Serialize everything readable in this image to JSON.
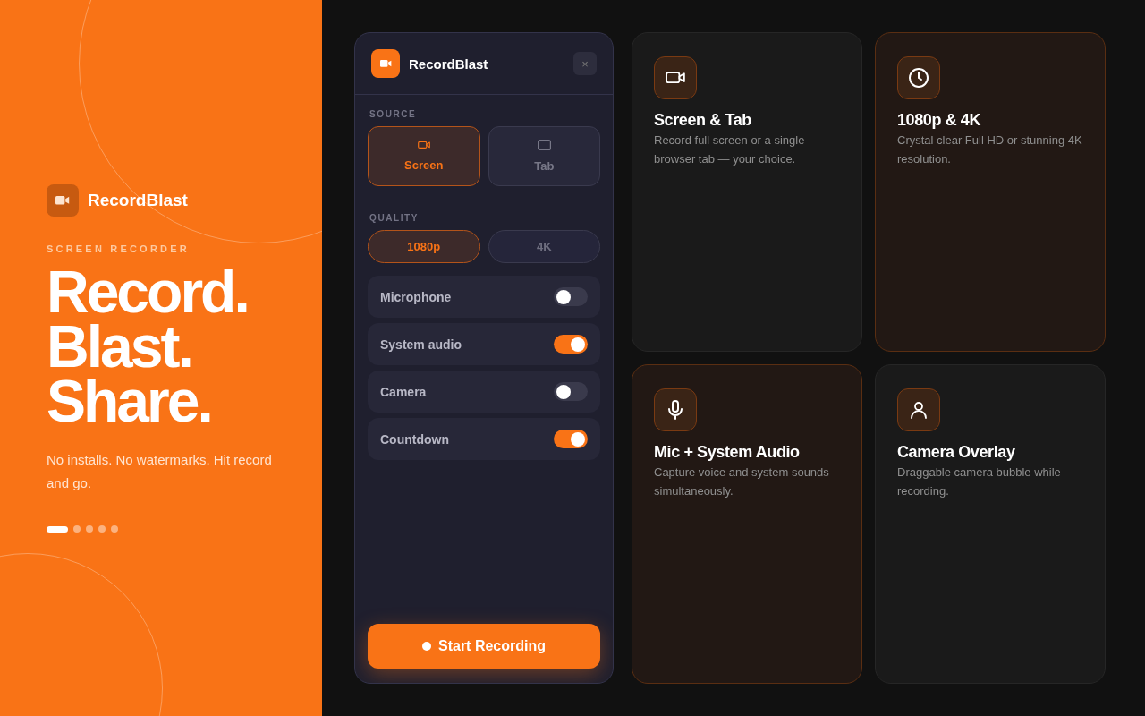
{
  "hero": {
    "brand": "RecordBlast",
    "eyebrow": "SCREEN RECORDER",
    "headline": [
      "Record.",
      "Blast.",
      "Share."
    ],
    "tagline": "No installs. No watermarks. Hit record and go.",
    "dots": [
      {
        "selected": true
      },
      {
        "selected": false
      },
      {
        "selected": false
      },
      {
        "selected": false
      },
      {
        "selected": false
      }
    ]
  },
  "panel": {
    "title": "RecordBlast",
    "close": "×",
    "source_label": "SOURCE",
    "sources": [
      {
        "label": "Screen",
        "selected": true
      },
      {
        "label": "Tab",
        "selected": false
      }
    ],
    "quality_label": "QUALITY",
    "qualities": [
      {
        "label": "1080p",
        "selected": true
      },
      {
        "label": "4K",
        "selected": false
      }
    ],
    "toggles": [
      {
        "label": "Microphone",
        "on": false
      },
      {
        "label": "System audio",
        "on": true
      },
      {
        "label": "Camera",
        "on": false
      },
      {
        "label": "Countdown",
        "on": true
      }
    ],
    "start_button": "Start Recording"
  },
  "features": [
    {
      "title": "Screen & Tab",
      "description": "Record full screen or a single browser tab — your choice.",
      "highlighted": false
    },
    {
      "title": "1080p & 4K",
      "description": "Crystal clear Full HD or stunning 4K resolution.",
      "highlighted": true
    },
    {
      "title": "Mic + System Audio",
      "description": "Capture voice and system sounds simultaneously.",
      "highlighted": true
    },
    {
      "title": "Camera Overlay",
      "description": "Draggable camera bubble while recording.",
      "highlighted": false
    }
  ]
}
